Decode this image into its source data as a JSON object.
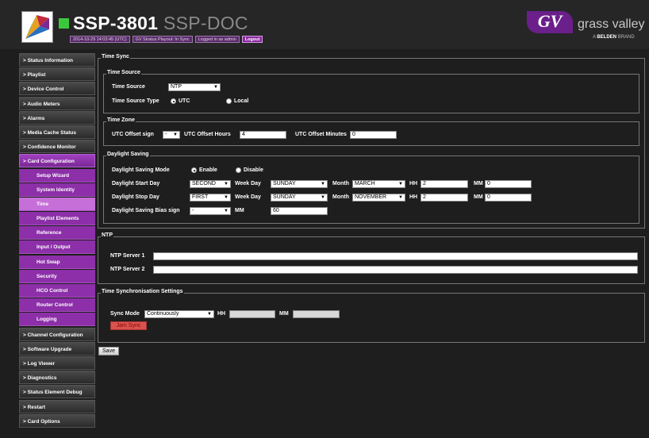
{
  "header": {
    "product": "SSP-3801",
    "model": "SSP-DOC",
    "status_items": [
      "2014-10-29 14:03:45 (UTC)",
      "GV Stratus Playout: In Sync",
      "Logged in as admin"
    ],
    "logout_label": "Logout",
    "brand": {
      "mark": "GV",
      "name": "grass valley",
      "sub_prefix": "A",
      "sub_bold": "BELDEN",
      "sub_suffix": "BRAND"
    },
    "colors": {
      "accent": "#8c2fa8",
      "status_ok": "#3cc83c"
    }
  },
  "sidebar": {
    "items": [
      {
        "label": "> Status Information"
      },
      {
        "label": "> Playlist"
      },
      {
        "label": "> Device Control"
      },
      {
        "label": "> Audio Meters"
      },
      {
        "label": "> Alarms"
      },
      {
        "label": "> Media Cache Status"
      },
      {
        "label": "> Confidence Monitor"
      },
      {
        "label": "> Card Configuration",
        "open": true
      }
    ],
    "subitems": [
      "Setup Wizard",
      "System Identity",
      "Time",
      "Playlist Elements",
      "Reference",
      "Input / Output",
      "Hot Swap",
      "Security",
      "HCO Control",
      "Router Control",
      "Logging"
    ],
    "active_subitem": "Time",
    "bottom_items": [
      "> Channel Configuration",
      "> Software Upgrade",
      "> Log Viewer",
      "> Diagnostics",
      "> Status Element Debug",
      "> Restart",
      "> Card Options"
    ]
  },
  "time_sync": {
    "title": "Time Sync",
    "time_source": {
      "title": "Time Source",
      "source_label": "Time Source",
      "source_value": "NTP",
      "type_label": "Time Source Type",
      "opt_utc": "UTC",
      "opt_local": "Local",
      "selected": "UTC"
    },
    "time_zone": {
      "title": "Time Zone",
      "sign_label": "UTC Offset sign",
      "sign_value": "-",
      "hours_label": "UTC Offset Hours",
      "hours_value": "4",
      "minutes_label": "UTC Offset Minutes",
      "minutes_value": "0"
    },
    "daylight": {
      "title": "Daylight Saving",
      "mode_label": "Daylight Saving Mode",
      "opt_enable": "Enable",
      "opt_disable": "Disable",
      "selected": "Enable",
      "start_label": "Daylight Start Day",
      "stop_label": "Daylight Stop Day",
      "week_day_label": "Week Day",
      "month_label": "Month",
      "hh_label": "HH",
      "mm_label": "MM",
      "start": {
        "week": "SECOND",
        "day": "SUNDAY",
        "month": "MARCH",
        "hh": "2",
        "mm": "0"
      },
      "stop": {
        "week": "FIRST",
        "day": "SUNDAY",
        "month": "NOVEMBER",
        "hh": "2",
        "mm": "0"
      },
      "bias_label": "Daylight Saving Bias sign",
      "bias_sign": "-",
      "bias_mm_label": "MM",
      "bias_mm_value": "60"
    }
  },
  "ntp": {
    "title": "NTP",
    "server1_label": "NTP Server 1",
    "server1_value": "",
    "server2_label": "NTP Server 2",
    "server2_value": ""
  },
  "sync_settings": {
    "title": "Time Synchronisation Settings",
    "mode_label": "Sync Mode",
    "mode_value": "Continuously",
    "hh_label": "HH",
    "hh_value": "",
    "mm_label": "MM",
    "mm_value": "",
    "jam_label": "Jam Sync"
  },
  "save_label": "Save"
}
